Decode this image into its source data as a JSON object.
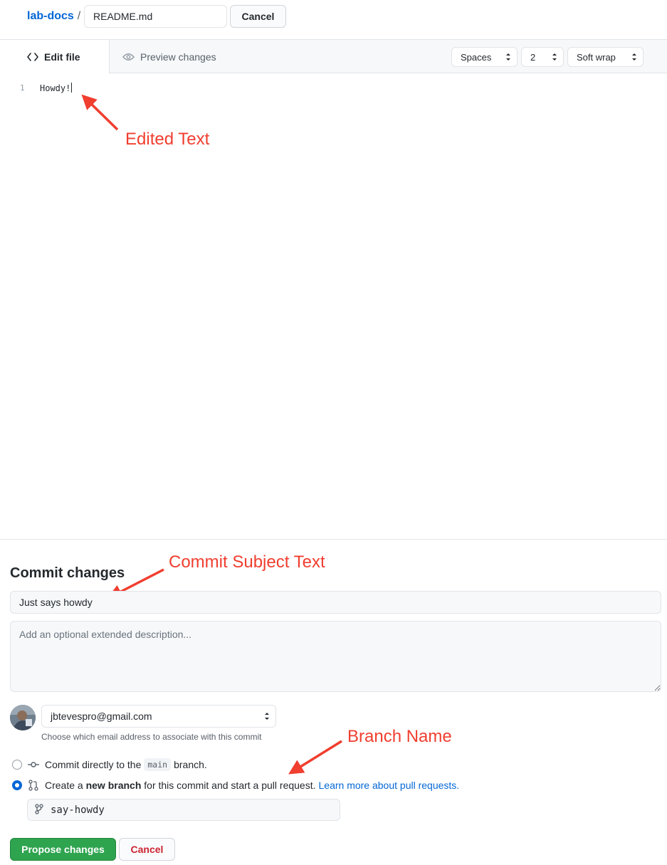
{
  "header": {
    "repo_name": "lab-docs",
    "separator": "/",
    "filename_value": "README.md",
    "cancel_label": "Cancel"
  },
  "tabs": {
    "edit_label": "Edit file",
    "preview_label": "Preview changes"
  },
  "editor_options": {
    "indent_mode": "Spaces",
    "indent_size": "2",
    "wrap_mode": "Soft wrap"
  },
  "editor": {
    "line_number": "1",
    "content": "Howdy!"
  },
  "annotations": {
    "edited_text": "Edited Text",
    "commit_subject_text": "Commit Subject Text",
    "branch_name": "Branch Name",
    "color": "#f03e2f"
  },
  "commit": {
    "title": "Commit changes",
    "subject_value": "Just says howdy",
    "description_placeholder": "Add an optional extended description...",
    "email_value": "jbtevespro@gmail.com",
    "email_note": "Choose which email address to associate with this commit",
    "option_direct_prefix": "Commit directly to the",
    "option_direct_branch": "main",
    "option_direct_suffix": "branch.",
    "option_new_prefix": "Create a",
    "option_new_bold": "new branch",
    "option_new_suffix": "for this commit and start a pull request.",
    "option_new_link": "Learn more about pull requests.",
    "selected_option": "new_branch",
    "branch_name_value": "say-howdy",
    "propose_label": "Propose changes",
    "cancel_label": "Cancel"
  },
  "colors": {
    "primary_green": "#2ea44f",
    "link_blue": "#0366d6",
    "danger_red": "#cb2431"
  }
}
